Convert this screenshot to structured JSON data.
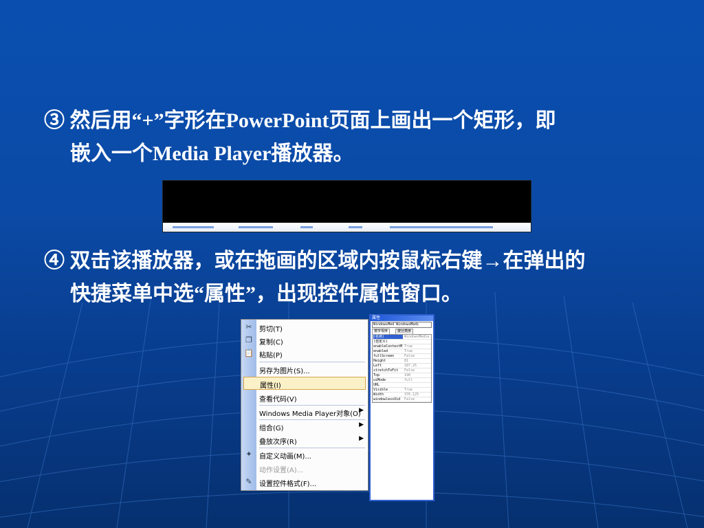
{
  "slide": {
    "step3": {
      "line1": "③ 然后用“+”字形在PowerPoint页面上画出一个矩形，即",
      "line2": "嵌入一个Media Player播放器。"
    },
    "step4": {
      "line1": "④ 双击该播放器，或在拖画的区域内按鼠标右键→在弹出的",
      "line2": "快捷菜单中选“属性”，出现控件属性窗口。"
    }
  },
  "context_menu": {
    "items": [
      {
        "label": "剪切(T)",
        "icon": "scissors-icon"
      },
      {
        "label": "复制(C)",
        "icon": "copy-icon"
      },
      {
        "label": "粘贴(P)",
        "icon": "paste-icon"
      },
      {
        "label": "另存为图片(S)..."
      },
      {
        "label": "属性(I)"
      },
      {
        "label": "查看代码(V)"
      },
      {
        "label": "Windows Media Player对象(O)",
        "submenu": true
      },
      {
        "label": "组合(G)",
        "submenu": true
      },
      {
        "label": "叠放次序(R)",
        "submenu": true
      },
      {
        "label": "自定义动画(M)...",
        "icon": "custom-animation-icon"
      },
      {
        "label": "动作设置(A)...",
        "disabled": true
      },
      {
        "label": "设置控件格式(F)...",
        "icon": "format-control-icon"
      }
    ]
  },
  "properties_window": {
    "title": "属性",
    "object": "WindowsMed WindowsMedi",
    "tabs": [
      "按字母序",
      "按分类序"
    ],
    "rows": [
      {
        "name": "(名称)",
        "value": "WindowsMedia"
      },
      {
        "name": "(自定义)",
        "value": ""
      },
      {
        "name": "enableContextM",
        "value": "True"
      },
      {
        "name": "enabled",
        "value": "True"
      },
      {
        "name": "fullScreen",
        "value": "False"
      },
      {
        "name": "Height",
        "value": "81"
      },
      {
        "name": "Left",
        "value": "187.25"
      },
      {
        "name": "stretchToFit",
        "value": "False"
      },
      {
        "name": "Top",
        "value": "190"
      },
      {
        "name": "uiMode",
        "value": "full"
      },
      {
        "name": "URL",
        "value": ""
      },
      {
        "name": "Visible",
        "value": "True"
      },
      {
        "name": "Width",
        "value": "376.125"
      },
      {
        "name": "windowlessVid",
        "value": "False"
      }
    ]
  }
}
